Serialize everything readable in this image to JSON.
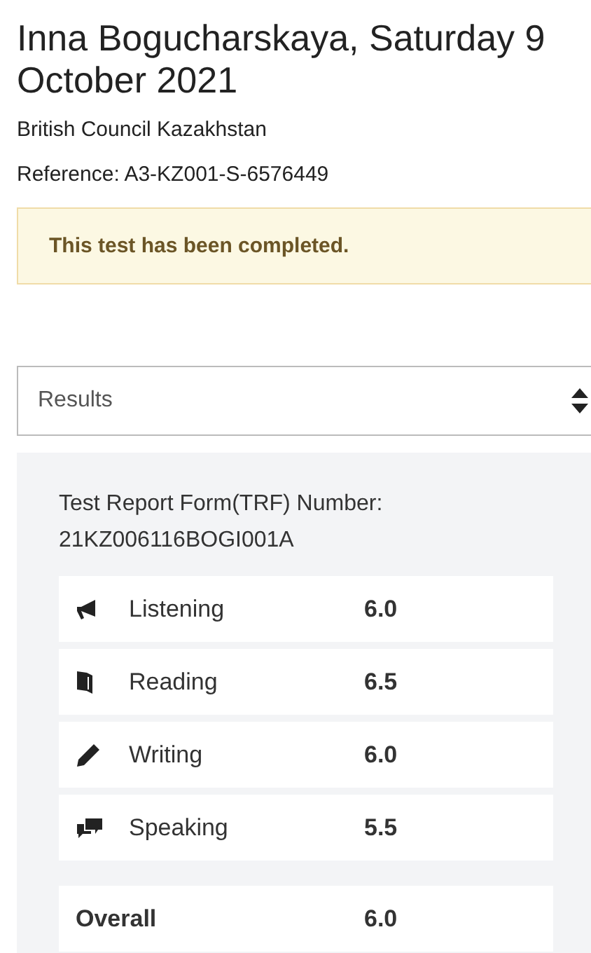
{
  "heading": {
    "title": "Inna Bogucharskaya, Saturday 9 October 2021",
    "centre": "British Council Kazakhstan",
    "reference": "Reference: A3-KZ001-S-6576449"
  },
  "alert": {
    "message": "This test has been completed."
  },
  "select": {
    "value": "Results"
  },
  "results": {
    "trf_label": "Test Report Form(TRF) Number:",
    "trf_number": "21KZ006116BOGI001A",
    "skills": [
      {
        "kind": "listening",
        "name": "Listening",
        "score": "6.0"
      },
      {
        "kind": "reading",
        "name": "Reading",
        "score": "6.5"
      },
      {
        "kind": "writing",
        "name": "Writing",
        "score": "6.0"
      },
      {
        "kind": "speaking",
        "name": "Speaking",
        "score": "5.5"
      }
    ],
    "overall": {
      "label": "Overall",
      "score": "6.0"
    }
  }
}
